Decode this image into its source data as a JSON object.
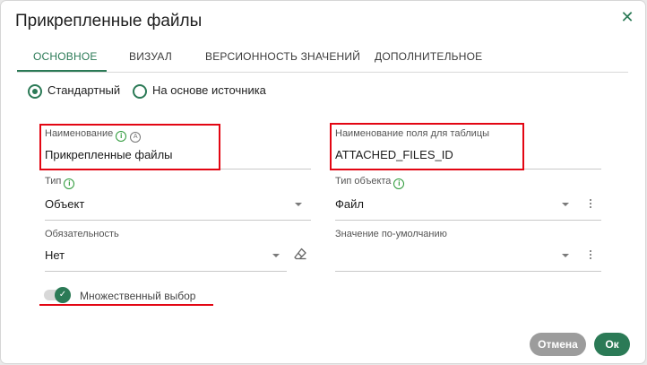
{
  "dialog": {
    "title": "Прикрепленные файлы",
    "close_icon": "close-icon"
  },
  "tabs": [
    {
      "label": "ОСНОВНОЕ",
      "active": true
    },
    {
      "label": "ВИЗУАЛ",
      "active": false
    },
    {
      "label": "ВЕРСИОННОСТЬ ЗНАЧЕНИЙ",
      "active": false
    },
    {
      "label": "ДОПОЛНИТЕЛЬНОЕ",
      "active": false
    }
  ],
  "mode": {
    "options": [
      {
        "label": "Стандартный",
        "selected": true
      },
      {
        "label": "На основе источника",
        "selected": false
      }
    ]
  },
  "fields": {
    "name": {
      "label": "Наименование",
      "value": "Прикрепленные файлы"
    },
    "table_field_name": {
      "label": "Наименование поля для таблицы",
      "value": "ATTACHED_FILES_ID"
    },
    "type": {
      "label": "Тип",
      "value": "Объект"
    },
    "object_type": {
      "label": "Тип объекта",
      "value": "Файл"
    },
    "required": {
      "label": "Обязательность",
      "value": "Нет"
    },
    "default_value": {
      "label": "Значение по-умолчанию",
      "value": ""
    }
  },
  "multiple_choice": {
    "label": "Множественный выбор",
    "enabled": true
  },
  "buttons": {
    "cancel": "Отмена",
    "ok": "Ок"
  },
  "colors": {
    "accent": "#2b7a56",
    "highlight": "#e30613",
    "info": "#2e9a3a"
  }
}
